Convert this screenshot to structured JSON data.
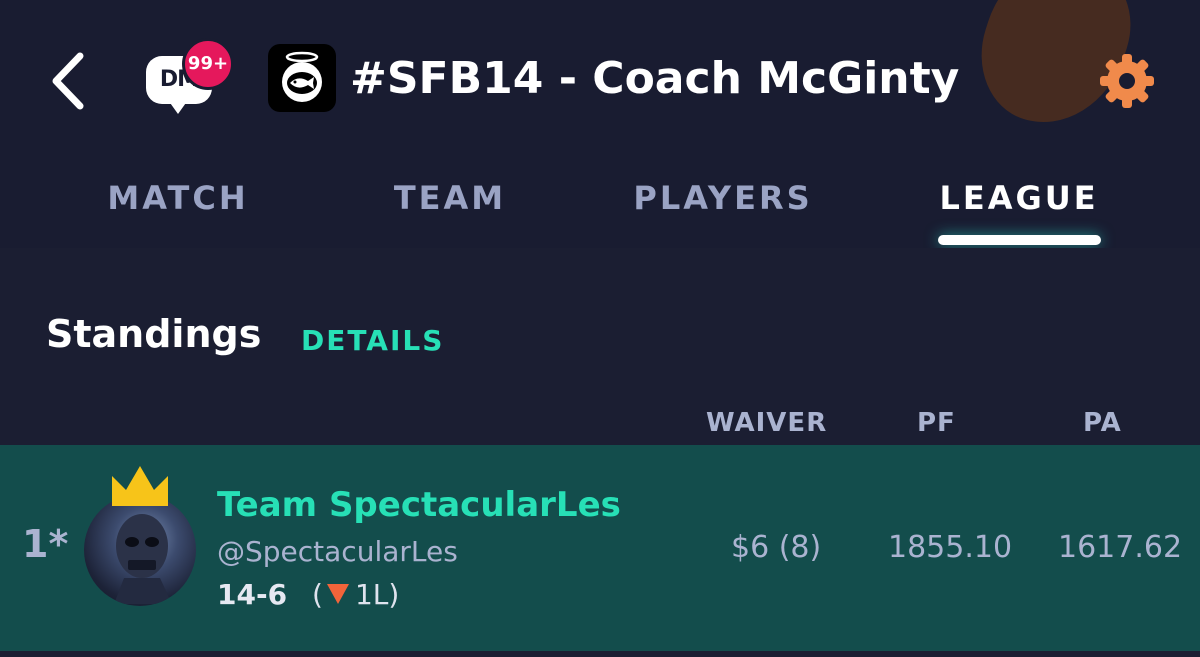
{
  "header": {
    "dm_label": "DM",
    "dm_badge": "99+",
    "league_title": "#SFB14 - Coach McGinty"
  },
  "tabs": [
    {
      "label": "MATCH"
    },
    {
      "label": "TEAM"
    },
    {
      "label": "PLAYERS"
    },
    {
      "label": "LEAGUE",
      "active": true
    }
  ],
  "standings": {
    "title": "Standings",
    "details_label": "DETAILS",
    "columns": [
      "WAIVER",
      "PF",
      "PA"
    ],
    "rows": [
      {
        "rank": "1*",
        "team_name": "Team SpectacularLes",
        "handle": "@SpectacularLes",
        "record": "14-6",
        "streak": "1L",
        "waiver": "$6 (8)",
        "pf": "1855.10",
        "pa": "1617.62"
      }
    ]
  },
  "colors": {
    "background": "#191c31",
    "accent": "#27e0b6",
    "row_highlight": "#134d4c",
    "badge": "#e5185c",
    "gear": "#f08a4b",
    "loss_streak": "#f2643a"
  }
}
